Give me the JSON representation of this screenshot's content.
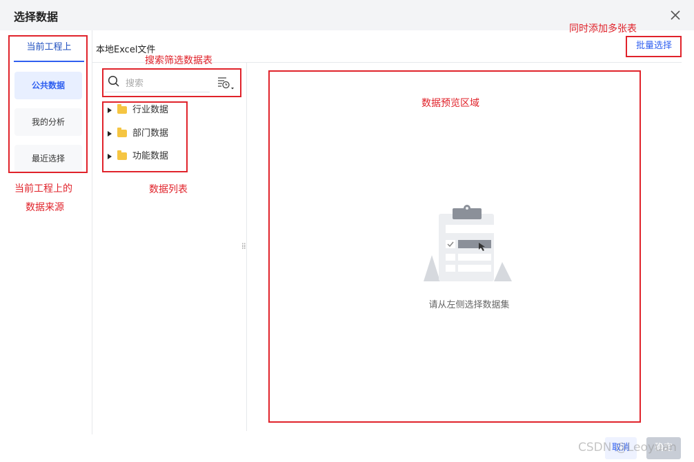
{
  "dialog": {
    "title": "选择数据"
  },
  "left": {
    "tab": "当前工程上",
    "sources": [
      {
        "label": "公共数据",
        "active": true
      },
      {
        "label": "我的分析",
        "active": false
      },
      {
        "label": "最近选择",
        "active": false
      }
    ]
  },
  "main": {
    "excel_tab": "本地Excel文件",
    "batch_button": "批量选择",
    "search_placeholder": "搜索",
    "tree": [
      "行业数据",
      "部门数据",
      "功能数据"
    ],
    "empty_text": "请从左侧选择数据集"
  },
  "annotations": {
    "batch": "同时添加多张表",
    "search": "搜索筛选数据表",
    "list": "数据列表",
    "preview": "数据预览区域",
    "source_line1": "当前工程上的",
    "source_line2": "数据来源"
  },
  "footer": {
    "cancel": "取消",
    "ok": "确定"
  },
  "watermark": "CSDN @Leoyuan",
  "colors": {
    "accent": "#2f5ff0",
    "annotation_red": "#e0222a",
    "folder": "#f5c542"
  },
  "icons": [
    "close-icon",
    "search-icon",
    "filter-icon",
    "folder-icon",
    "expand-arrow-icon",
    "drag-handle-icon"
  ]
}
